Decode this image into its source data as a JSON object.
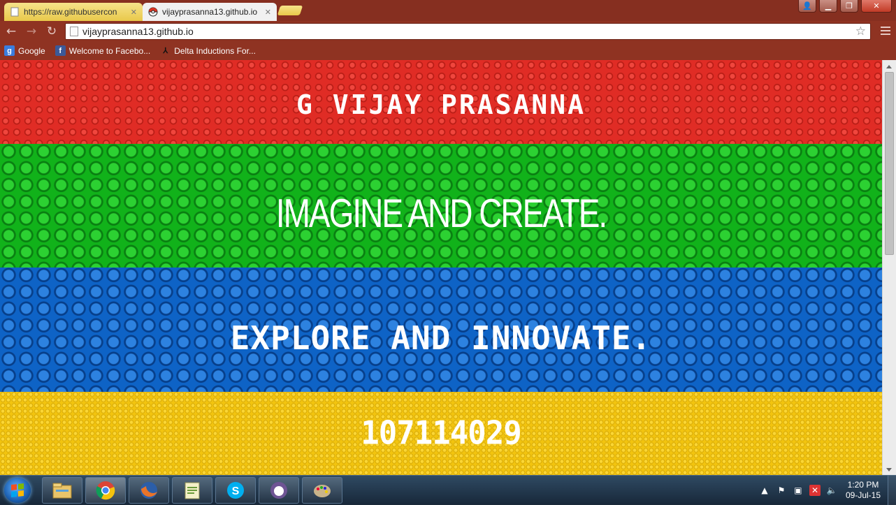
{
  "browser": {
    "tabs": [
      {
        "title": "https://raw.githubusercon",
        "active": false
      },
      {
        "title": "vijayprasanna13.github.io",
        "active": true
      }
    ],
    "address_url": "vijayprasanna13.github.io",
    "bookmarks": [
      {
        "label": "Google",
        "icon": "google-icon"
      },
      {
        "label": "Welcome to Facebo...",
        "icon": "facebook-icon"
      },
      {
        "label": "Delta Inductions For...",
        "icon": "delta-icon"
      }
    ],
    "window_controls": [
      "user-icon",
      "minimize-icon",
      "maximize-icon",
      "close-icon"
    ]
  },
  "page": {
    "bands": [
      {
        "text": "G Vijay Prasanna",
        "color": "#e02c25"
      },
      {
        "text": "Imagine and create.",
        "color": "#11b21a"
      },
      {
        "text": "Explore and innovate.",
        "color": "#0e63c6"
      },
      {
        "text": "107114029",
        "color": "#f2c40f"
      }
    ]
  },
  "taskbar": {
    "apps": [
      "windows-explorer-icon",
      "chrome-icon",
      "firefox-icon",
      "notepad-plus-plus-icon",
      "skype-icon",
      "github-icon",
      "paint-icon"
    ],
    "active_app": "chrome-icon",
    "clock_time": "1:20 PM",
    "clock_date": "09-Jul-15"
  },
  "colors": {
    "chrome_frame": "#862f20",
    "taskbar": "#18283a"
  }
}
